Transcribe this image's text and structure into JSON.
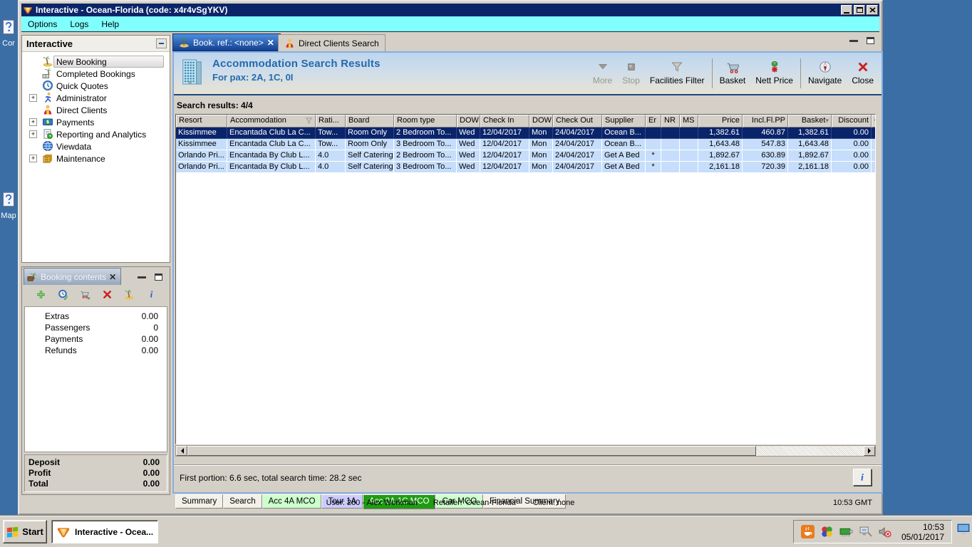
{
  "colors": {
    "desktop": "#3b6ea5",
    "title_bar": "#0b2569",
    "menu_bar": "#80ffff",
    "selected_row": "#0a246a",
    "row_blue": "#c6defb",
    "active_bottom_tab": "#1f9c14"
  },
  "desktop": {
    "icons": [
      {
        "label": "Cor",
        "icon": "question-doc-icon"
      },
      {
        "label": "Map",
        "icon": "question-doc-icon"
      }
    ]
  },
  "window": {
    "icon": "app-logo-icon",
    "title": "Interactive - Ocean-Florida (code: x4r4vSgYKV)",
    "menu": [
      {
        "label": "Options"
      },
      {
        "label": "Logs"
      },
      {
        "label": "Help"
      }
    ]
  },
  "sidebar": {
    "title": "Interactive",
    "items": [
      {
        "label": "New Booking",
        "icon": "palm-island-icon",
        "expandable": false,
        "selected": true
      },
      {
        "label": "Completed Bookings",
        "icon": "palm-money-icon",
        "expandable": false,
        "selected": false
      },
      {
        "label": "Quick Quotes",
        "icon": "clock-icon",
        "expandable": false,
        "selected": false
      },
      {
        "label": "Administrator",
        "icon": "runner-icon",
        "expandable": true,
        "selected": false
      },
      {
        "label": "Direct Clients",
        "icon": "client-icon",
        "expandable": false,
        "selected": false
      },
      {
        "label": "Payments",
        "icon": "payments-icon",
        "expandable": true,
        "selected": false
      },
      {
        "label": "Reporting and Analytics",
        "icon": "report-icon",
        "expandable": true,
        "selected": false
      },
      {
        "label": "Viewdata",
        "icon": "globe-icon",
        "expandable": false,
        "selected": false
      },
      {
        "label": "Maintenance",
        "icon": "drawer-icon",
        "expandable": true,
        "selected": false
      }
    ]
  },
  "booking_contents": {
    "title": "Booking contents",
    "toolbar": [
      {
        "name": "add",
        "icon": "plus-icon"
      },
      {
        "name": "refresh",
        "icon": "clock-globe-icon"
      },
      {
        "name": "to-basket",
        "icon": "basket-go-icon"
      },
      {
        "name": "delete",
        "icon": "red-x-icon"
      },
      {
        "name": "holiday",
        "icon": "palm-island-icon"
      },
      {
        "name": "info",
        "icon": "info-icon"
      }
    ],
    "rows": [
      {
        "label": "Extras",
        "value": "0.00"
      },
      {
        "label": "Passengers",
        "value": "0"
      },
      {
        "label": "Payments",
        "value": "0.00"
      },
      {
        "label": "Refunds",
        "value": "0.00"
      }
    ],
    "totals": [
      {
        "label": "Deposit",
        "value": "0.00"
      },
      {
        "label": "Profit",
        "value": "0.00"
      },
      {
        "label": "Total",
        "value": "0.00"
      }
    ]
  },
  "main": {
    "tabs": [
      {
        "label": "Book. ref.: <none>",
        "icon": "palm-island-icon",
        "active": true,
        "closable": true
      },
      {
        "label": "Direct Clients Search",
        "icon": "client-icon",
        "active": false,
        "closable": false
      }
    ],
    "header": {
      "icon": "building-icon",
      "title": "Accommodation Search Results",
      "subtitle": "For pax: 2A, 1C, 0I"
    },
    "toolbar": [
      {
        "label": "More",
        "icon": "more-icon",
        "enabled": false
      },
      {
        "label": "Stop",
        "icon": "stop-icon",
        "enabled": false
      },
      {
        "label": "Facilities Filter",
        "icon": "funnel-icon",
        "enabled": true
      },
      {
        "sep": true
      },
      {
        "label": "Basket",
        "icon": "cart-icon",
        "enabled": true
      },
      {
        "label": "Nett Price",
        "icon": "nett-price-icon",
        "enabled": true
      },
      {
        "sep": true
      },
      {
        "label": "Navigate",
        "icon": "compass-icon",
        "enabled": true
      },
      {
        "label": "Close",
        "icon": "close-red-icon",
        "enabled": true
      }
    ],
    "search_results_label": "Search results: 4/4",
    "table": {
      "columns": [
        "Resort",
        "Accommodation",
        "Rati...",
        "Board",
        "Room type",
        "DOW",
        "Check In",
        "DOW",
        "Check Out",
        "Supplier",
        "Er",
        "NR",
        "MS",
        "Price",
        "Incl.Fl.PP",
        "Basket",
        "Discount",
        "C"
      ],
      "rows": [
        [
          "Kissimmee",
          "Encantada Club La C...",
          "Tow...",
          "Room Only",
          "2 Bedroom To...",
          "Wed",
          "12/04/2017",
          "Mon",
          "24/04/2017",
          "Ocean B...",
          "",
          "",
          "",
          "1,382.61",
          "460.87",
          "1,382.61",
          "0.00",
          ""
        ],
        [
          "Kissimmee",
          "Encantada Club La C...",
          "Tow...",
          "Room Only",
          "3 Bedroom To...",
          "Wed",
          "12/04/2017",
          "Mon",
          "24/04/2017",
          "Ocean B...",
          "",
          "",
          "",
          "1,643.48",
          "547.83",
          "1,643.48",
          "0.00",
          ""
        ],
        [
          "Orlando Pri...",
          "Encantada By Club L...",
          "4.0",
          "Self Catering",
          "2 Bedroom To...",
          "Wed",
          "12/04/2017",
          "Mon",
          "24/04/2017",
          "Get A Bed",
          "*",
          "",
          "",
          "1,892.67",
          "630.89",
          "1,892.67",
          "0.00",
          ""
        ],
        [
          "Orlando Pri...",
          "Encantada By Club L...",
          "4.0",
          "Self Catering",
          "3 Bedroom To...",
          "Wed",
          "12/04/2017",
          "Mon",
          "24/04/2017",
          "Get A Bed",
          "*",
          "",
          "",
          "2,161.18",
          "720.39",
          "2,161.18",
          "0.00",
          ""
        ]
      ],
      "selected_row": 0
    },
    "timing_label": "First portion: 6.6 sec, total search time: 28.2 sec",
    "bottom_tabs": [
      {
        "label": "Summary",
        "bg": "#f2f0e8",
        "fg": "#000000",
        "active": false
      },
      {
        "label": "Search",
        "bg": "#f2f0e8",
        "fg": "#000000",
        "active": false
      },
      {
        "label": "Acc 4A MCO",
        "bg": "#ccffcc",
        "fg": "#000000",
        "active": false
      },
      {
        "label": "Tour 1A",
        "bg": "#ccccff",
        "fg": "#000000",
        "active": false
      },
      {
        "label": "Acc 2A,1C MCO",
        "bg": "#1f9c14",
        "fg": "#ffffff",
        "active": true
      },
      {
        "label": "Car MCO",
        "bg": "#ccffcc",
        "fg": "#000000",
        "active": false
      },
      {
        "label": "Financial Summary",
        "bg": "#f2f0e8",
        "fg": "#000000",
        "active": false
      }
    ],
    "status_bar": {
      "user": "User: 260 - Alex Workman",
      "retailer": "Retailer: 'Ocean-Florida'",
      "client": "Client: none",
      "time": "10:53 GMT"
    }
  },
  "taskbar": {
    "start_label": "Start",
    "tasks": [
      {
        "label": "Interactive - Ocea...",
        "icon": "app-logo-icon",
        "active": true
      }
    ],
    "tray_icons": [
      "java-icon",
      "colors-icon",
      "netcard-icon",
      "network-icon",
      "mute-speaker-icon"
    ],
    "clock": {
      "time": "10:53",
      "date": "05/01/2017"
    }
  }
}
